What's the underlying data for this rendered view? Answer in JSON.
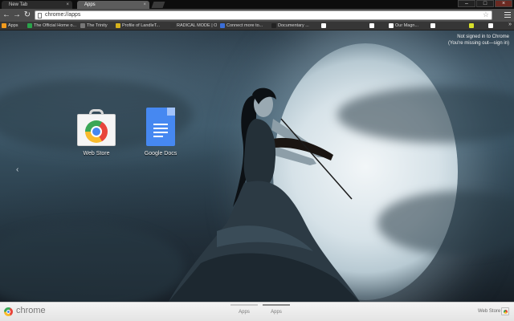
{
  "tabs": [
    {
      "title": "New Tab"
    },
    {
      "title": "Apps"
    }
  ],
  "window_controls": [
    "minimize-icon",
    "maximize-icon",
    "close-icon"
  ],
  "toolbar": {
    "back_icon": "arrow-left-icon",
    "forward_icon": "arrow-right-icon",
    "reload_icon": "reload-icon",
    "url": "chrome://apps",
    "bookmark_star_icon": "star-icon",
    "menu_icon": "menu-icon"
  },
  "bookmarks": [
    {
      "label": "Apps",
      "color": "#f29b1d"
    },
    {
      "label": "The Official Home o...",
      "color": "#2aa34a"
    },
    {
      "label": "The Trinity",
      "color": "#777777"
    },
    {
      "label": "Profile of LandleT...",
      "color": "#d6b21c"
    },
    {
      "label": "RADICAL MODE | Onli...",
      "color": "#333333"
    },
    {
      "label": "Connect more to...",
      "color": "#3a6ed8"
    },
    {
      "label": "Documentary ...",
      "color": "#222222"
    },
    {
      "label": "",
      "color": "#ffffff"
    },
    {
      "label": "",
      "color": "#ffffff"
    },
    {
      "label": "Our Magn...",
      "color": "#ffffff"
    },
    {
      "label": "",
      "color": "#ffffff"
    },
    {
      "label": "",
      "color": "#d8e02a"
    },
    {
      "label": "",
      "color": "#ffffff"
    }
  ],
  "signin": {
    "line1": "Not signed in to Chrome",
    "line2": "(You're missing out—sign in)"
  },
  "apps": [
    {
      "name": "Web Store",
      "icon": "web-store-icon"
    },
    {
      "name": "Google Docs",
      "icon": "google-docs-icon"
    }
  ],
  "nav": {
    "previous_page_icon": "chevron-left-icon"
  },
  "bottom": {
    "brand": "chrome",
    "pages": [
      {
        "label": "Apps",
        "active": false
      },
      {
        "label": "Apps",
        "active": true
      }
    ],
    "webstore_link": "Web Store"
  }
}
